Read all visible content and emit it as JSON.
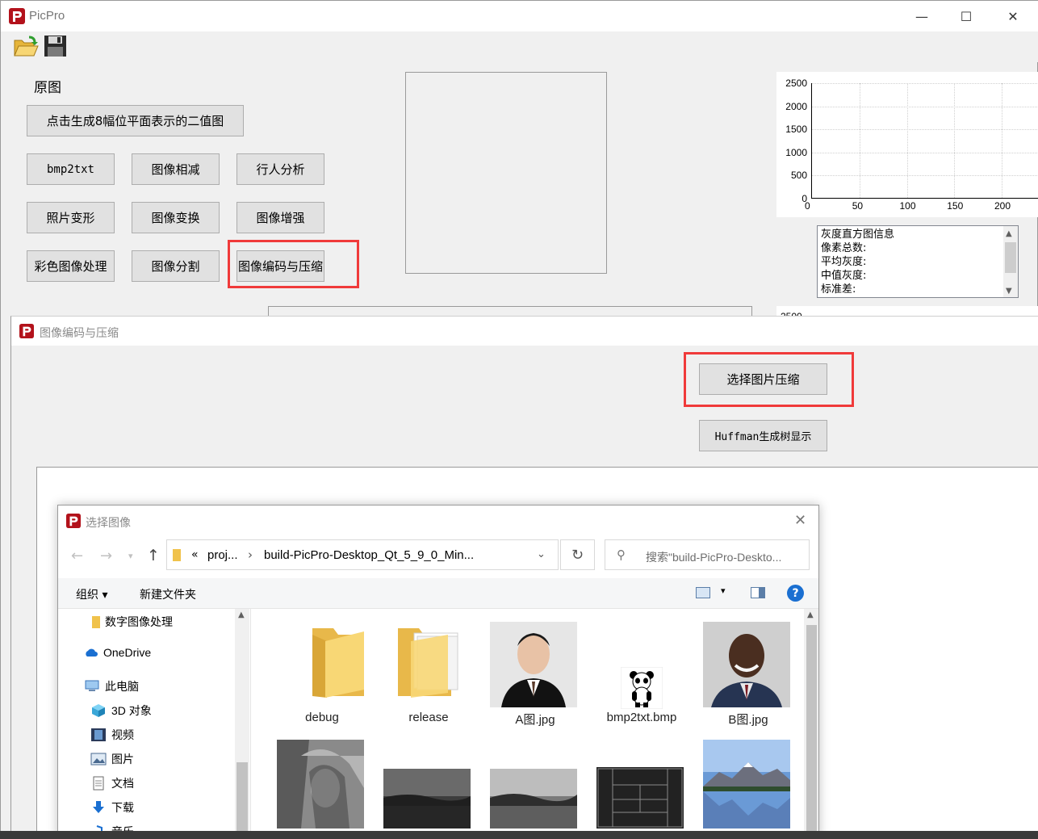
{
  "main_window": {
    "title": "PicPro",
    "controls": {
      "minimize": "—",
      "maximize": "☐",
      "close": "✕"
    },
    "original_label": "原图",
    "buttons": {
      "bitplane": "点击生成8幅位平面表示的二值图",
      "bmp2txt": "bmp2txt",
      "subtract": "图像相减",
      "pedestrian": "行人分析",
      "photo_warp": "照片变形",
      "transform": "图像变换",
      "enhance": "图像增强",
      "color": "彩色图像处理",
      "segment": "图像分割",
      "encode": "图像编码与压缩"
    },
    "histogram": {
      "y_ticks": [
        "2500",
        "2000",
        "1500",
        "1000",
        "500",
        "0"
      ],
      "x_ticks": [
        "0",
        "50",
        "100",
        "150",
        "200"
      ]
    },
    "info_lines": [
      "灰度直方图信息",
      "像素总数:",
      "平均灰度:",
      "中值灰度:",
      "标准差:"
    ],
    "second_chart_tick_partial": "2500"
  },
  "chart_data": {
    "type": "bar",
    "title": "",
    "xlabel": "",
    "ylabel": "",
    "x_ticks": [
      0,
      50,
      100,
      150,
      200
    ],
    "y_ticks": [
      0,
      500,
      1000,
      1500,
      2000,
      2500
    ],
    "ylim": [
      0,
      2500
    ],
    "series": [],
    "grid": true
  },
  "compress_window": {
    "title": "图像编码与压缩",
    "select_button": "选择图片压缩",
    "huffman_button": "Huffman生成树显示"
  },
  "file_dialog": {
    "title": "选择图像",
    "close": "✕",
    "breadcrumb": [
      "«",
      "proj...",
      "›",
      "build-PicPro-Desktop_Qt_5_9_0_Min..."
    ],
    "search_placeholder": "搜索\"build-PicPro-Deskto...",
    "organize": "组织 ▾",
    "new_folder": "新建文件夹",
    "nav_items": [
      "数字图像处理",
      "OneDrive",
      "此电脑",
      "3D 对象",
      "视频",
      "图片",
      "文档",
      "下载",
      "音乐"
    ],
    "files": [
      "debug",
      "release",
      "A图.jpg",
      "bmp2txt.bmp",
      "B图.jpg"
    ],
    "colors": {
      "folder": "#f8d775",
      "accent": "#1a6fd1",
      "highlight": "#f03a3a"
    }
  }
}
